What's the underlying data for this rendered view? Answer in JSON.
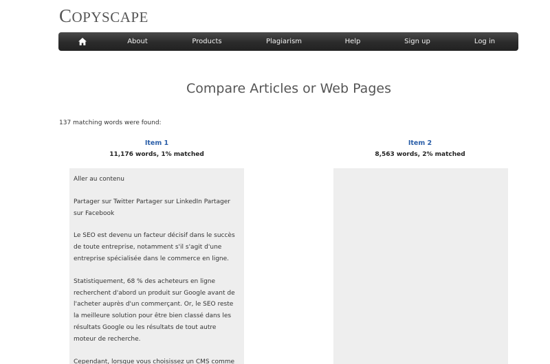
{
  "logo": {
    "first": "C",
    "rest": "OPYSCAPE"
  },
  "nav": {
    "about": "About",
    "products": "Products",
    "plagiarism": "Plagiarism",
    "help": "Help",
    "signup": "Sign up",
    "login": "Log in"
  },
  "page_title": "Compare Articles or Web Pages",
  "match_text": "137 matching words were found:",
  "item1": {
    "title": "Item 1",
    "stats": "11,176 words, 1% matched"
  },
  "item2": {
    "title": "Item 2",
    "stats": "8,563 words, 2% matched"
  },
  "item1_paragraphs": [
    "Aller au contenu",
    "Partager sur Twitter Partager sur LinkedIn Partager sur Facebook",
    "Le SEO est devenu un facteur décisif dans le succès de toute entreprise, notamment s'il s'agit d'une entreprise spécialisée dans le commerce en ligne.",
    "Statistiquement, 68 % des acheteurs en ligne recherchent d'abord un produit sur Google avant de l'acheter auprès d'un commerçant. Or, le SEO reste la meilleure solution pour être bien classé dans les résultats Google ou les résultats de tout autre moteur de recherche.",
    "Cependant, lorsque vous choisissez un CMS comme"
  ],
  "colors": {
    "nav_bg": "#2b2b2b",
    "item_title": "#2a5ea8",
    "panel_bg": "#eeeeee"
  }
}
